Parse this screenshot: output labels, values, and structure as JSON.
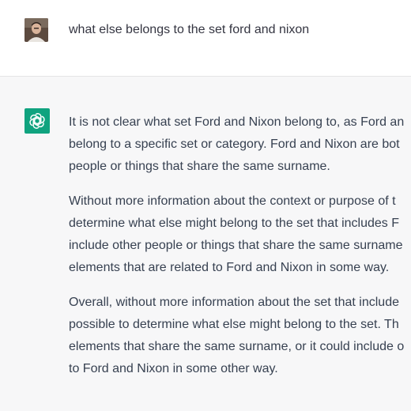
{
  "user_message": {
    "text": "what else belongs to the set ford and nixon"
  },
  "assistant_message": {
    "paragraphs": [
      {
        "lines": [
          "It is not clear what set Ford and Nixon belong to, as Ford an",
          "belong to a specific set or category. Ford and Nixon are bot",
          "people or things that share the same surname."
        ]
      },
      {
        "lines": [
          "Without more information about the context or purpose of t",
          "determine what else might belong to the set that includes F",
          "include other people or things that share the same surname",
          "elements that are related to Ford and Nixon in some way."
        ]
      },
      {
        "lines": [
          "Overall, without more information about the set that include",
          "possible to determine what else might belong to the set. Th",
          "elements that share the same surname, or it could include o",
          "to Ford and Nixon in some other way."
        ]
      }
    ]
  },
  "icons": {
    "user_avatar": "user-photo-avatar",
    "assistant_logo": "openai-logo-icon"
  },
  "colors": {
    "assistant_bg": "#f7f7f8",
    "logo_bg": "#10a37f",
    "text": "#374151"
  }
}
